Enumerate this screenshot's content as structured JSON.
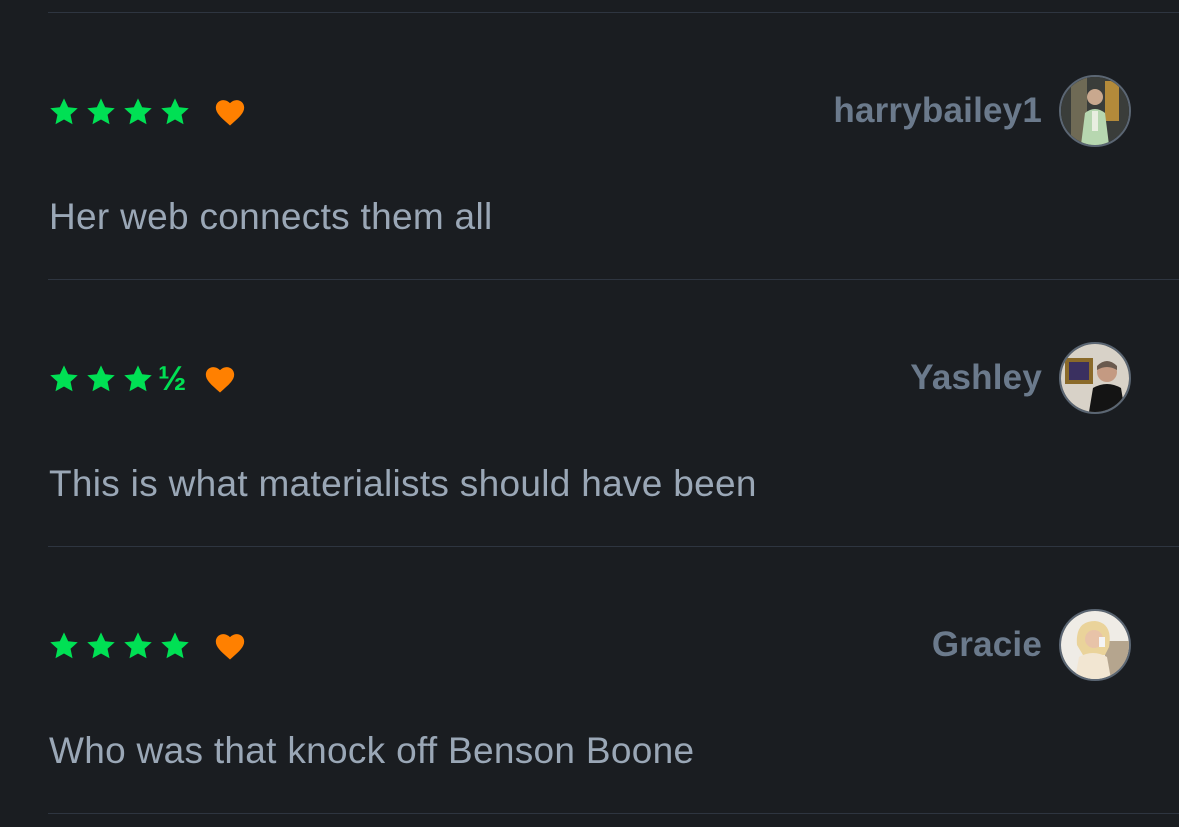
{
  "colors": {
    "background": "#1a1d21",
    "divider": "#2e3540",
    "star_green": "#00e054",
    "heart_orange": "#ff8000",
    "username": "#6b7a8c",
    "review_text": "#9aa7b6"
  },
  "reviews": [
    {
      "rating": 4,
      "rating_half": "",
      "liked": true,
      "username": "harrybailey1",
      "avatar_icon": "avatar-man-light-suit",
      "text": "Her web connects them all"
    },
    {
      "rating": 3.5,
      "rating_half": "½",
      "liked": true,
      "username": "Yashley",
      "avatar_icon": "avatar-man-dark-sweater",
      "text": "This is what materialists should have been"
    },
    {
      "rating": 4,
      "rating_half": "",
      "liked": true,
      "username": "Gracie",
      "avatar_icon": "avatar-blonde-woman",
      "text": "Who was that knock off Benson Boone"
    }
  ]
}
